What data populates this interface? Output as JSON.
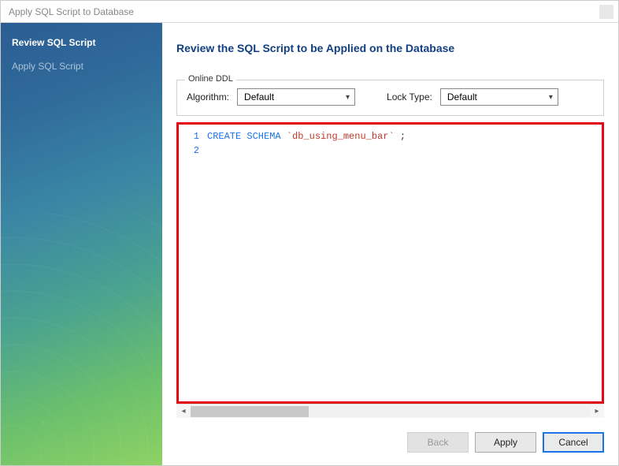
{
  "window": {
    "title": "Apply SQL Script to Database"
  },
  "sidebar": {
    "steps": [
      {
        "label": "Review SQL Script",
        "active": true
      },
      {
        "label": "Apply SQL Script",
        "active": false
      }
    ]
  },
  "main": {
    "heading": "Review the SQL Script to be Applied on the Database",
    "onlineDdl": {
      "legend": "Online DDL",
      "algorithmLabel": "Algorithm:",
      "algorithmValue": "Default",
      "lockTypeLabel": "Lock Type:",
      "lockTypeValue": "Default"
    },
    "sql": {
      "lines": [
        {
          "n": "1",
          "kw": "CREATE SCHEMA",
          "str": "`db_using_menu_bar`",
          "tail": " ;"
        },
        {
          "n": "2",
          "kw": "",
          "str": "",
          "tail": ""
        }
      ]
    },
    "buttons": {
      "back": "Back",
      "apply": "Apply",
      "cancel": "Cancel"
    }
  }
}
